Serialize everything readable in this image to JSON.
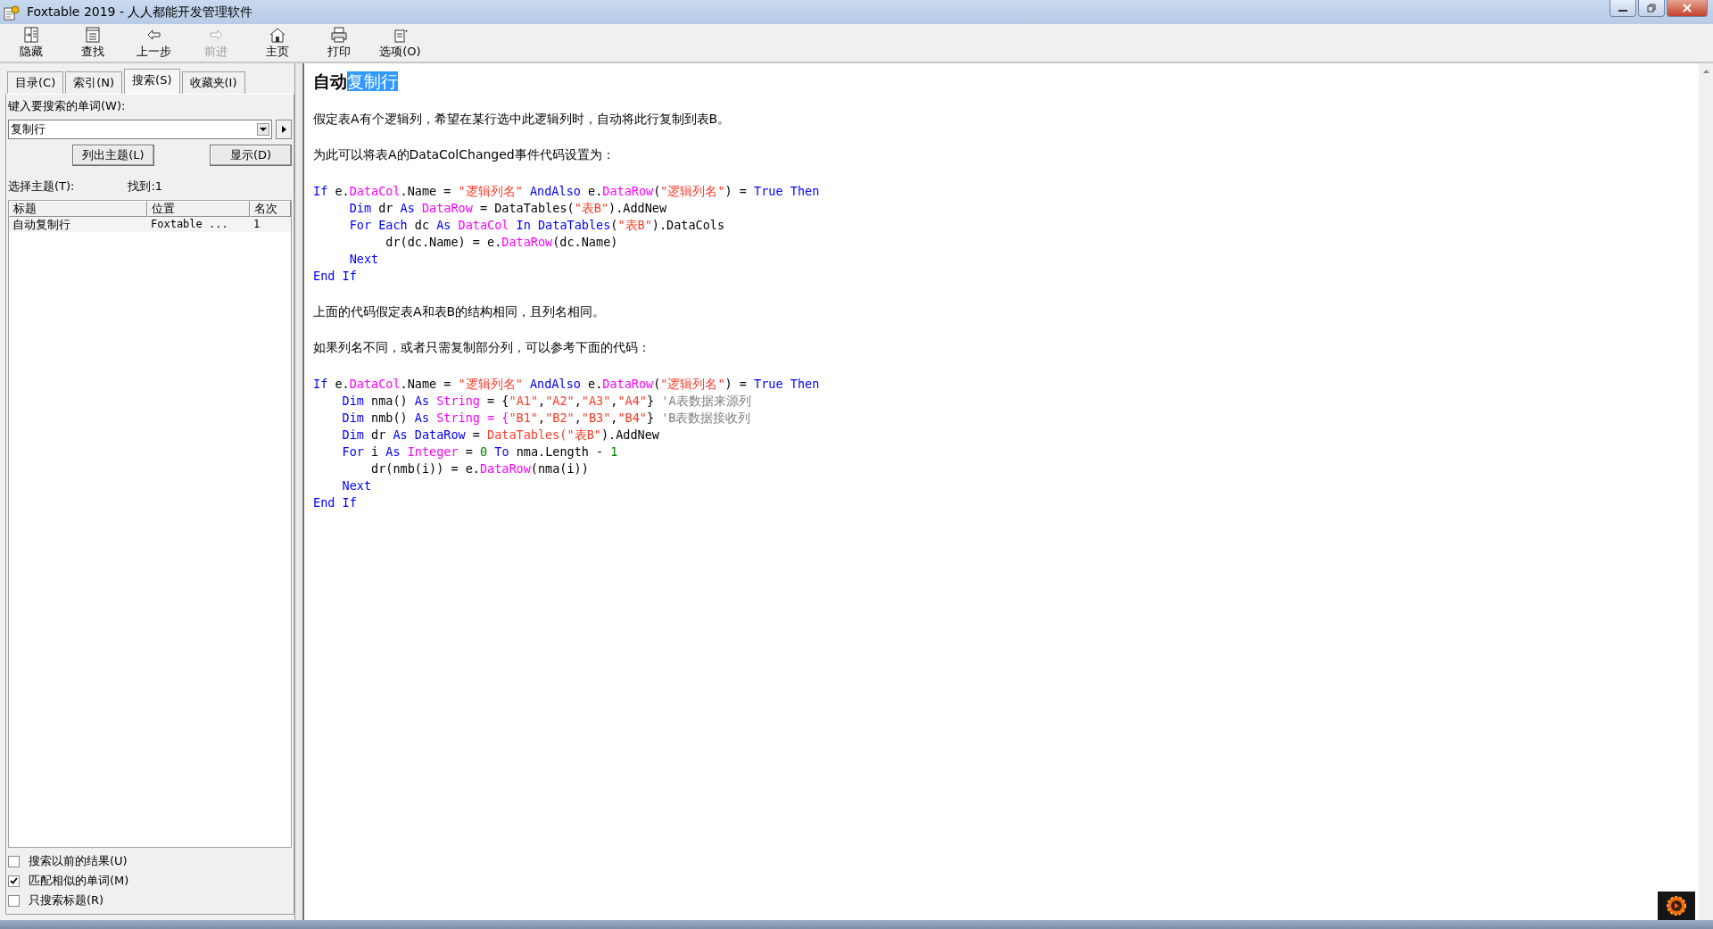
{
  "window": {
    "title": "Foxtable 2019 - 人人都能开发管理软件"
  },
  "toolbar": [
    {
      "label": "隐藏",
      "disabled": false
    },
    {
      "label": "查找",
      "disabled": false
    },
    {
      "label": "上一步",
      "disabled": false
    },
    {
      "label": "前进",
      "disabled": true
    },
    {
      "label": "主页",
      "disabled": false
    },
    {
      "label": "打印",
      "disabled": false
    },
    {
      "label": "选项(O)",
      "disabled": false
    }
  ],
  "sidebar": {
    "tabs": [
      {
        "label": "目录(C)",
        "selected": false
      },
      {
        "label": "索引(N)",
        "selected": false
      },
      {
        "label": "搜索(S)",
        "selected": true
      },
      {
        "label": "收藏夹(I)",
        "selected": false
      }
    ],
    "search_label": "键入要搜索的单词(W):",
    "search_value": "复制行",
    "list_button": "列出主题(L)",
    "show_button": "显示(D)",
    "topic_label": "选择主题(T):",
    "found": "找到:1",
    "columns": [
      "标题",
      "位置",
      "名次"
    ],
    "rows": [
      {
        "cells": [
          "自动复制行",
          "Foxtable ...",
          "1"
        ],
        "selected": false
      }
    ],
    "options": [
      {
        "label": "搜索以前的结果(U)",
        "checked": false
      },
      {
        "label": "匹配相似的单词(M)",
        "checked": true
      },
      {
        "label": "只搜索标题(R)",
        "checked": false
      }
    ]
  },
  "content": {
    "title_parts": [
      {
        "text": "自动",
        "highlighted": false
      },
      {
        "text": "复制行",
        "highlighted": true
      }
    ],
    "blocks": [
      {
        "kind": "para",
        "text": "假定表A有个逻辑列，希望在某行选中此逻辑列时，自动将此行复制到表B。"
      },
      {
        "kind": "para",
        "text": "为此可以将表A的DataColChanged事件代码设置为："
      },
      {
        "kind": "code",
        "lines": [
          [
            {
              "t": "If",
              "color": "#0000ff"
            },
            {
              "t": " e."
            },
            {
              "t": "DataCol",
              "color": "#ff00ff"
            },
            {
              "t": ".Name = "
            },
            {
              "t": "\"逻辑列名\"",
              "color": "#ff3c28"
            },
            {
              "t": " AndAlso",
              "color": "#0000ff"
            },
            {
              "t": " e."
            },
            {
              "t": "DataRow",
              "color": "#ff00ff"
            },
            {
              "t": "("
            },
            {
              "t": "\"逻辑列名\"",
              "color": "#ff3c28"
            },
            {
              "t": ") = "
            },
            {
              "t": "True Then",
              "color": "#0000ff"
            }
          ],
          [
            {
              "t": "     Dim",
              "color": "#0000ff"
            },
            {
              "t": " dr "
            },
            {
              "t": "As",
              "color": "#0000ff"
            },
            {
              "t": " DataRow",
              "color": "#ff00ff"
            },
            {
              "t": " = DataTables("
            },
            {
              "t": "\"表B\"",
              "color": "#ff3c28"
            },
            {
              "t": ").AddNew"
            }
          ],
          [
            {
              "t": "     For Each",
              "color": "#0000ff"
            },
            {
              "t": " dc "
            },
            {
              "t": "As",
              "color": "#0000ff"
            },
            {
              "t": " DataCol",
              "color": "#ff00ff"
            },
            {
              "t": " In DataTables",
              "color": "#0000ff"
            },
            {
              "t": "("
            },
            {
              "t": "\"表B\"",
              "color": "#ff3c28"
            },
            {
              "t": ").DataCols"
            }
          ],
          [
            {
              "t": "          dr(dc.Name) = e."
            },
            {
              "t": "DataRow",
              "color": "#ff00ff"
            },
            {
              "t": "(dc.Name)"
            }
          ],
          [
            {
              "t": "     Next",
              "color": "#0000ff"
            }
          ],
          [
            {
              "t": "End If",
              "color": "#0000ff"
            }
          ]
        ]
      },
      {
        "kind": "para",
        "text": "上面的代码假定表A和表B的结构相同，且列名相同。"
      },
      {
        "kind": "para",
        "text": "如果列名不同，或者只需复制部分列，可以参考下面的代码："
      },
      {
        "kind": "code",
        "lines": [
          [
            {
              "t": "If",
              "color": "#0000ff"
            },
            {
              "t": " e."
            },
            {
              "t": "DataCol",
              "color": "#ff00ff"
            },
            {
              "t": ".Name = "
            },
            {
              "t": "\"逻辑列名\"",
              "color": "#ff3c28"
            },
            {
              "t": " AndAlso",
              "color": "#0000ff"
            },
            {
              "t": " e."
            },
            {
              "t": "DataRow",
              "color": "#ff00ff"
            },
            {
              "t": "("
            },
            {
              "t": "\"逻辑列名\"",
              "color": "#ff3c28"
            },
            {
              "t": ") = "
            },
            {
              "t": "True Then",
              "color": "#0000ff"
            }
          ],
          [
            {
              "t": "    Dim",
              "color": "#0000ff"
            },
            {
              "t": " nma() "
            },
            {
              "t": "As",
              "color": "#0000ff"
            },
            {
              "t": " String",
              "color": "#ff00ff"
            },
            {
              "t": " = {"
            },
            {
              "t": "\"A1\"",
              "color": "#ff3c28"
            },
            {
              "t": ","
            },
            {
              "t": "\"A2\"",
              "color": "#ff3c28"
            },
            {
              "t": ","
            },
            {
              "t": "\"A3\"",
              "color": "#ff3c28"
            },
            {
              "t": ","
            },
            {
              "t": "\"A4\"",
              "color": "#ff3c28"
            },
            {
              "t": "} "
            },
            {
              "t": "'A表数据来源列",
              "color": "#808080"
            }
          ],
          [
            {
              "t": "    Dim",
              "color": "#0000ff"
            },
            {
              "t": " nmb() "
            },
            {
              "t": "As",
              "color": "#0000ff"
            },
            {
              "t": " String = {",
              "color": "#ff00ff"
            },
            {
              "t": "\"B1\"",
              "color": "#ff3c28"
            },
            {
              "t": ","
            },
            {
              "t": "\"B2\"",
              "color": "#ff3c28"
            },
            {
              "t": ","
            },
            {
              "t": "\"B3\"",
              "color": "#ff3c28"
            },
            {
              "t": ","
            },
            {
              "t": "\"B4\"",
              "color": "#ff3c28"
            },
            {
              "t": "} "
            },
            {
              "t": "'B表数据接收列",
              "color": "#808080"
            }
          ],
          [
            {
              "t": "    Dim",
              "color": "#0000ff"
            },
            {
              "t": " dr "
            },
            {
              "t": "As DataRow",
              "color": "#0000ff"
            },
            {
              "t": " = "
            },
            {
              "t": "DataTables(\"表B\"",
              "color": "#ff3c28"
            },
            {
              "t": ").AddNew"
            }
          ],
          [
            {
              "t": "    For",
              "color": "#0000ff"
            },
            {
              "t": " i "
            },
            {
              "t": "As",
              "color": "#0000ff"
            },
            {
              "t": " Integer",
              "color": "#ff00ff"
            },
            {
              "t": " = "
            },
            {
              "t": "0",
              "color": "#008000"
            },
            {
              "t": " To",
              "color": "#0000ff"
            },
            {
              "t": " nma.Length - "
            },
            {
              "t": "1",
              "color": "#008000"
            }
          ],
          [
            {
              "t": "        dr(nmb(i)) = e."
            },
            {
              "t": "DataRow",
              "color": "#ff00ff"
            },
            {
              "t": "(nma(i))"
            }
          ],
          [
            {
              "t": "    Next",
              "color": "#0000ff"
            }
          ],
          [
            {
              "t": "End If",
              "color": "#0000ff"
            }
          ]
        ]
      }
    ]
  }
}
